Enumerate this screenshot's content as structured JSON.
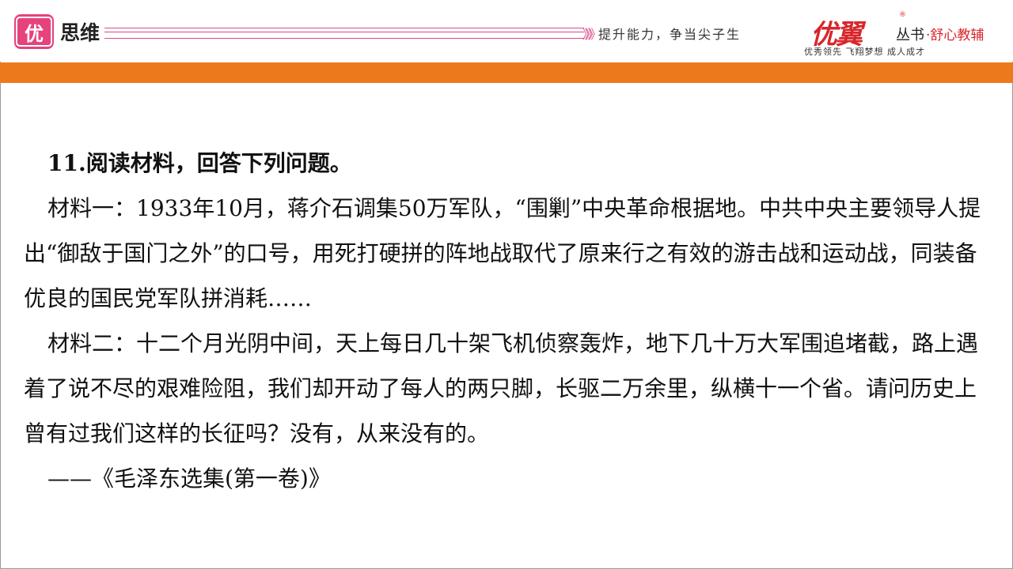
{
  "header": {
    "logo_char": "优",
    "brand_name": "思维",
    "chevrons": "》》》",
    "slogan": "提升能力，争当尖子生",
    "series_brand": "优翼",
    "registered_mark": "®",
    "series_word": "丛书",
    "series_tag": "·舒心教辅",
    "series_sub": "优秀领先 飞翔梦想 成人成才"
  },
  "banner": {
    "url": "http://www.youyi100.com/"
  },
  "question": {
    "title": "11.阅读材料，回答下列问题。",
    "material1": "材料一：1933年10月，蒋介石调集50万军队，“围剿”中央革命根据地。中共中央主要领导人提出“御敌于国门之外”的口号，用死打硬拼的阵地战取代了原来行之有效的游击战和运动战，同装备优良的国民党军队拼消耗……",
    "material2": "材料二：十二个月光阴中间，天上每日几十架飞机侦察轰炸，地下几十万大军围追堵截，路上遇着了说不尽的艰难险阻，我们却开动了每人的两只脚，长驱二万余里，纵横十一个省。请问历史上曾有过我们这样的长征吗？没有，从来没有的。",
    "source": "——《毛泽东选集(第一卷)》"
  },
  "colors": {
    "orange_bar": "#ec7a1c",
    "brand_red": "#d8262b",
    "logo_pink": "#e6427d"
  }
}
